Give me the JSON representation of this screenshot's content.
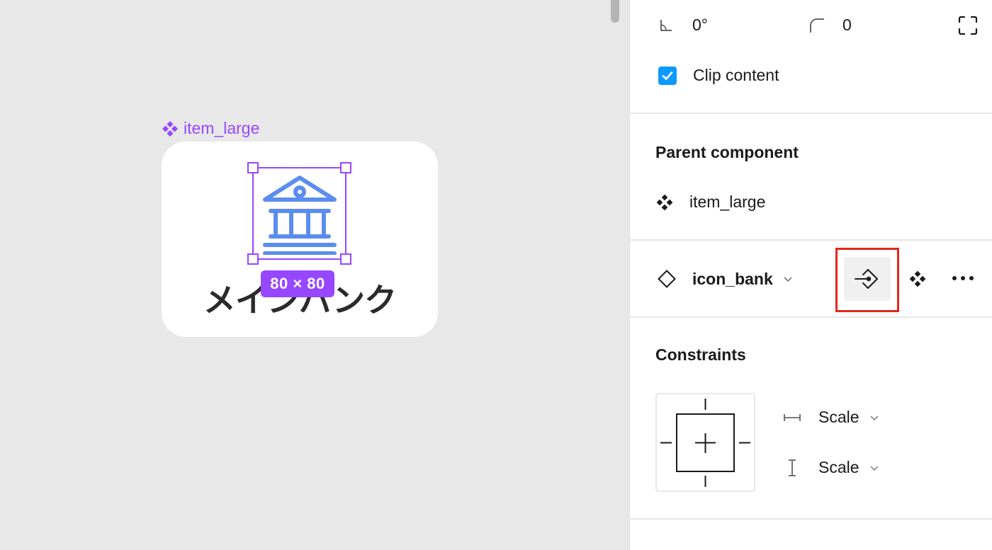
{
  "canvas": {
    "component_name": "item_large",
    "card_text": "メインバンク",
    "size_badge": "80 × 80",
    "accent_color": "#9747ff",
    "icon_color": "#5b8def"
  },
  "panel": {
    "rotation": "0°",
    "corner_radius": "0",
    "clip_content_label": "Clip content",
    "clip_content_checked": true,
    "parent_component_heading": "Parent component",
    "parent_component_name": "item_large",
    "instance_name": "icon_bank",
    "constraints_heading": "Constraints",
    "horizontal_constraint": "Scale",
    "vertical_constraint": "Scale",
    "highlight_color": "#e5271c",
    "checkbox_color": "#0d99ff"
  }
}
